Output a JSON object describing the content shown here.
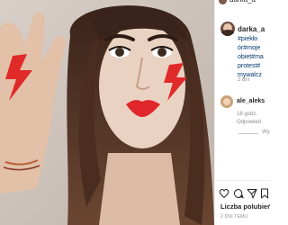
{
  "photo": {
    "alt_colors": {
      "lips": "#e0262a",
      "bolt": "#e02a2a",
      "hair": "#4a2e20",
      "skin": "#e8cdbd"
    }
  },
  "panel": {
    "top_snippet": "darka_a",
    "post": {
      "username": "darka_a",
      "caption_lines": [
        "#piekło",
        "ór#moje",
        "obiet#ma",
        "protest#",
        "mywalcz"
      ],
      "time_ago": "2 dni"
    },
    "comment": {
      "username": "ale_aleks",
      "time": "18 godz.",
      "reply": "Odpowied",
      "view_more": "Wy"
    },
    "actions": {
      "like_icon": "heart-icon",
      "comment_icon": "comment-icon",
      "share_icon": "share-icon",
      "save_icon": "bookmark-icon"
    },
    "likes_label": "Liczba polubień:",
    "date": "2 DNI TEMU"
  }
}
